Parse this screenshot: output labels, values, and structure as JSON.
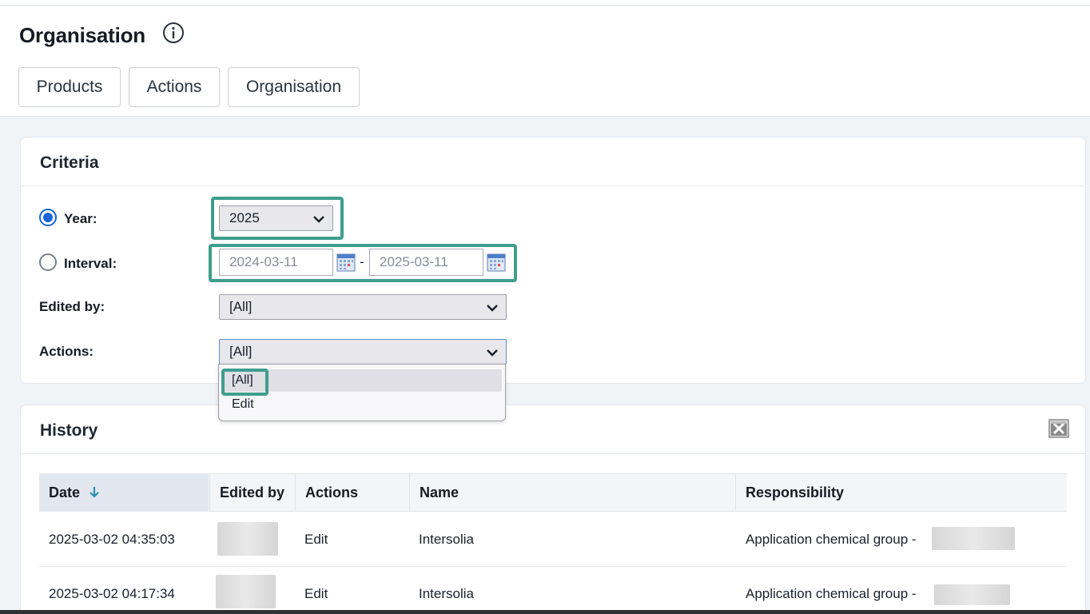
{
  "page": {
    "title": "Organisation",
    "tabs": [
      {
        "label": "Products"
      },
      {
        "label": "Actions"
      },
      {
        "label": "Organisation"
      }
    ]
  },
  "criteria": {
    "title": "Criteria",
    "year": {
      "label": "Year:",
      "selected": true,
      "value": "2025"
    },
    "interval": {
      "label": "Interval:",
      "selected": false,
      "from": "2024-03-11",
      "separator": "-",
      "to": "2025-03-11"
    },
    "edited_by": {
      "label": "Edited by:",
      "value": "[All]"
    },
    "actions": {
      "label": "Actions:",
      "value": "[All]",
      "options": [
        "[All]",
        "Edit"
      ]
    }
  },
  "history": {
    "title": "History",
    "columns": [
      "Date",
      "Edited by",
      "Actions",
      "Name",
      "Responsibility"
    ],
    "rows": [
      {
        "date": "2025-03-02 04:35:03",
        "action": "Edit",
        "name": "Intersolia",
        "responsibility": "Application chemical group -"
      },
      {
        "date": "2025-03-02 04:17:34",
        "action": "Edit",
        "name": "Intersolia",
        "responsibility": "Application chemical group -"
      }
    ]
  },
  "colors": {
    "accent": "#3f9e8d",
    "radio": "#1566d6",
    "sort_arrow": "#2a8fb0"
  }
}
